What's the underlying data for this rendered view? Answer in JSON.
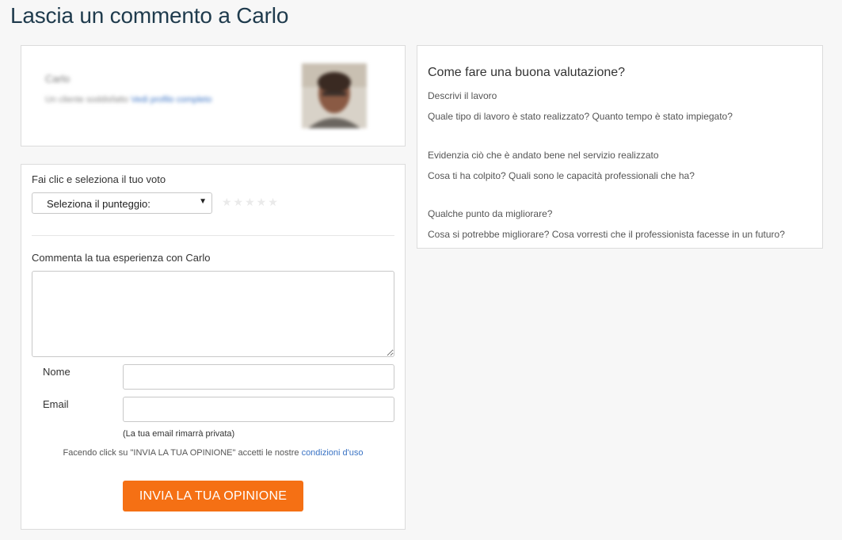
{
  "page": {
    "title": "Lascia un commento a Carlo"
  },
  "professional": {
    "name": "Carlo",
    "meta_text": "Un cliente soddisfatto",
    "link_text": "Vedi profilo completo"
  },
  "form": {
    "rating_label": "Fai clic e seleziona il tuo voto",
    "rating_select_value": "Seleziona il punteggio:",
    "stars": "★★★★★",
    "comment_label": "Commenta la tua esperienza con Carlo",
    "comment_value": "",
    "name_label": "Nome",
    "name_value": "",
    "email_label": "Email",
    "email_value": "",
    "email_note": "(La tua email rimarrà privata)",
    "terms_prefix": "Facendo click su \"INVIA LA TUA OPINIONE\" accetti le nostre ",
    "terms_link": "condizioni d'uso",
    "submit_label": "INVIA LA TUA OPINIONE"
  },
  "tips": {
    "title": "Come fare una buona valutazione?",
    "items": [
      {
        "heading": "Descrivi il lavoro",
        "text": "Quale tipo di lavoro è stato realizzato? Quanto tempo è stato impiegato?"
      },
      {
        "heading": "Evidenzia ciò che è andato bene nel servizio realizzato",
        "text": "Cosa ti ha colpito? Quali sono le capacità professionali che ha?"
      },
      {
        "heading": "Qualche punto da migliorare?",
        "text": "Cosa si potrebbe migliorare? Cosa vorresti che il professionista facesse in un futuro?"
      }
    ]
  },
  "colors": {
    "accent": "#f57014",
    "title": "#1f3b4d",
    "link": "#3a73c4"
  }
}
